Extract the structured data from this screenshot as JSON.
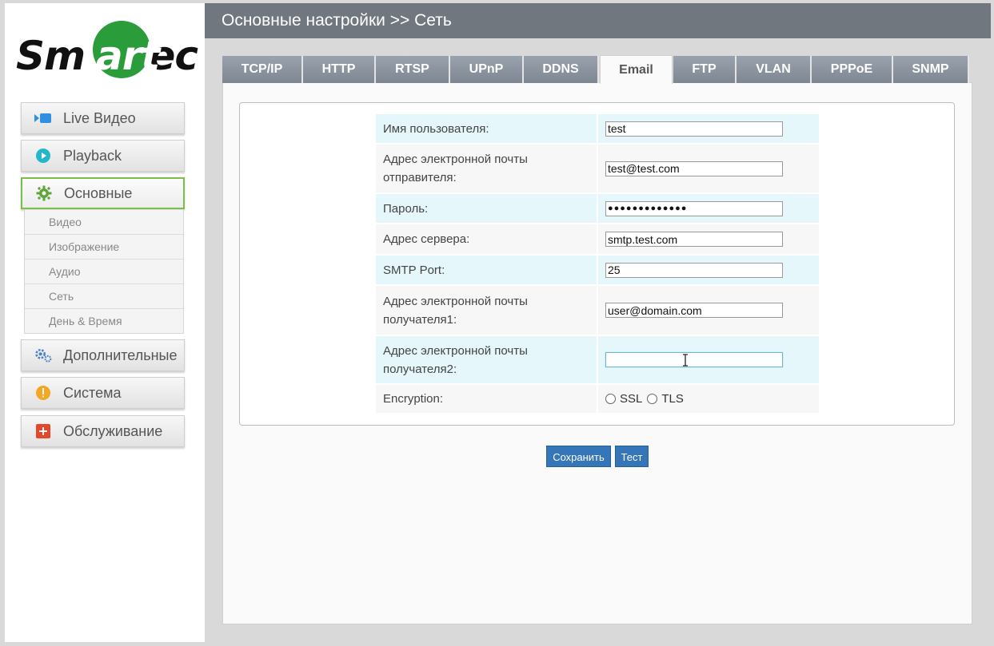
{
  "logo": {
    "text_left": "Sm",
    "text_mid": "art",
    "text_right": "ec",
    "brand_color": "#2a9d3a"
  },
  "sidebar": {
    "buttons": [
      {
        "label": "Live Видео",
        "icon": "live-video-icon"
      },
      {
        "label": "Playback",
        "icon": "play-icon"
      },
      {
        "label": "Основные",
        "icon": "gear-icon"
      },
      {
        "label": "Дополнительные",
        "icon": "gears-icon"
      },
      {
        "label": "Система",
        "icon": "alert-icon"
      },
      {
        "label": "Обслуживание",
        "icon": "plus-icon"
      }
    ],
    "submenu": [
      "Видео",
      "Изображение",
      "Аудио",
      "Сеть",
      "День & Время"
    ]
  },
  "header": {
    "title": "Основные настройки >> Сеть"
  },
  "tabs": [
    "TCP/IP",
    "HTTP",
    "RTSP",
    "UPnP",
    "DDNS",
    "Email",
    "FTP",
    "VLAN",
    "PPPoE",
    "SNMP"
  ],
  "active_tab": "Email",
  "form": {
    "username_label": "Имя пользователя:",
    "username_value": "test",
    "sender_label_1": "Адрес электронной почты",
    "sender_label_2": "отправителя:",
    "sender_value": "test@test.com",
    "password_label": "Пароль:",
    "password_value": "●●●●●●●●●●●●●",
    "server_label": "Адрес сервера:",
    "server_value": "smtp.test.com",
    "port_label": "SMTP Port:",
    "port_value": "25",
    "recipient1_label_1": "Адрес электронной почты",
    "recipient1_label_2": "получателя1:",
    "recipient1_value": "user@domain.com",
    "recipient2_label_1": "Адрес электронной почты",
    "recipient2_label_2": "получателя2:",
    "recipient2_value": "",
    "encryption_label": "Encryption:",
    "encryption_options": [
      "SSL",
      "TLS"
    ]
  },
  "buttons": {
    "save": "Сохранить",
    "test": "Тест"
  }
}
